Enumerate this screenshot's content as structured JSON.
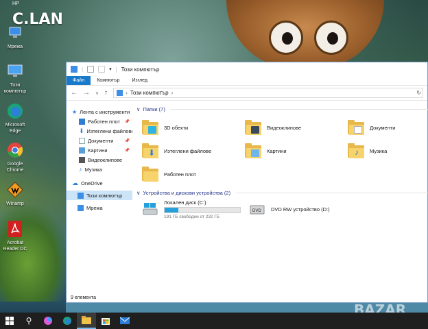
{
  "desktop": {
    "top_label": "HP",
    "overlay_title": "C.LAN",
    "watermark": "BAZAR",
    "icons": [
      {
        "label": "Мрежа",
        "icon": "network-icon"
      },
      {
        "label": "Този компютър",
        "icon": "computer-icon"
      },
      {
        "label": "Microsoft Edge",
        "icon": "edge-icon"
      },
      {
        "label": "Google Chrome",
        "icon": "chrome-icon"
      },
      {
        "label": "Winamp",
        "icon": "winamp-icon"
      },
      {
        "label": "Acrobat Reader DC",
        "icon": "acrobat-icon"
      }
    ]
  },
  "window": {
    "title": "Този компютър",
    "ribbon_tabs": [
      "Файл",
      "Компютър",
      "Изглед"
    ],
    "address": "Този компютър",
    "nav": {
      "quick_access": "Лента с инструменти",
      "items": [
        "Работен плот",
        "Изтеглени файлове",
        "Документи",
        "Картини",
        "Видеоклипове",
        "Музика"
      ],
      "onedrive": "OneDrive",
      "this_pc": "Този компютър",
      "network": "Мрежа"
    },
    "folders_header": "Папки (7)",
    "folders": [
      "3D обекти",
      "Видеоклипове",
      "Документи",
      "Изтеглени файлове",
      "Картини",
      "Музика",
      "Работен плот"
    ],
    "devices_header": "Устройства и дискови устройства (2)",
    "drives": [
      {
        "name": "Локален диск (C:)",
        "detail": "191 ГБ свободни от 232 ГБ",
        "used_fraction": 0.18
      },
      {
        "name": "DVD RW устройство (D:)",
        "detail": ""
      }
    ],
    "status": "9 елемента"
  }
}
